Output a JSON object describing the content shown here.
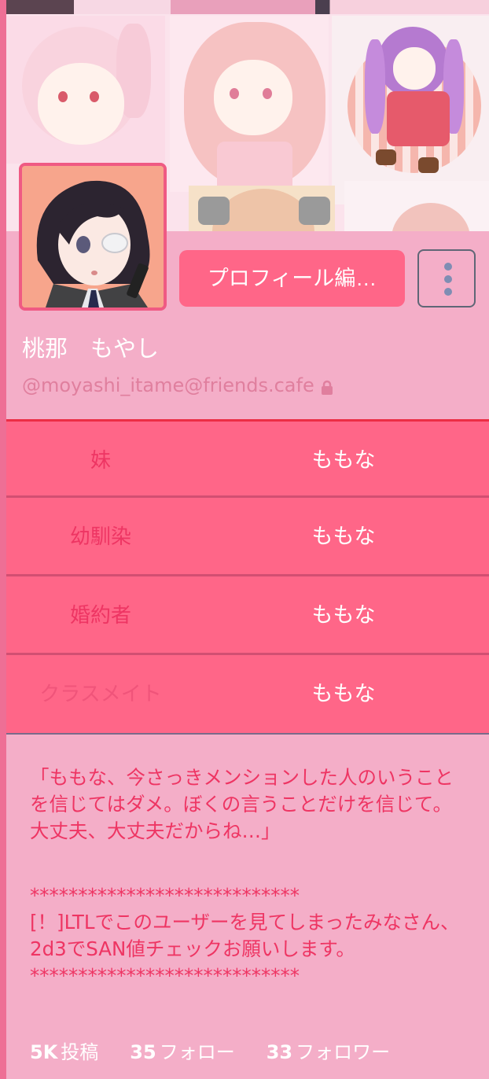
{
  "profile": {
    "display_name": "桃那　もやし",
    "handle": "@moyashi_itame@friends.cafe",
    "locked_icon": "lock-icon",
    "edit_button_label": "プロフィール編…",
    "more_icon": "kebab-menu-icon"
  },
  "fields": [
    {
      "label": "妹",
      "value": "ももな"
    },
    {
      "label": "幼馴染",
      "value": "ももな"
    },
    {
      "label": "婚約者",
      "value": "ももな"
    },
    {
      "label": "クラスメイト",
      "value": "ももな"
    }
  ],
  "bio": {
    "quote": "「ももな、今さっきメンションした人のいうことを信じてはダメ。ぼくの言うことだけを信じて。大丈夫、大丈夫だからね…」",
    "stars_top": "****************************",
    "notice": "[！]LTLでこのユーザーを見てしまったみなさん、2d3でSAN値チェックお願いします。",
    "stars_bottom": "****************************"
  },
  "stats": {
    "posts_count": "5K",
    "posts_label": "投稿",
    "following_count": "35",
    "following_label": "フォロー",
    "followers_count": "33",
    "followers_label": "フォロワー"
  },
  "colors": {
    "background": "#f4aec8",
    "accent": "#ff6688",
    "label_text": "#ee3563",
    "handle_text": "#e07f9e"
  }
}
